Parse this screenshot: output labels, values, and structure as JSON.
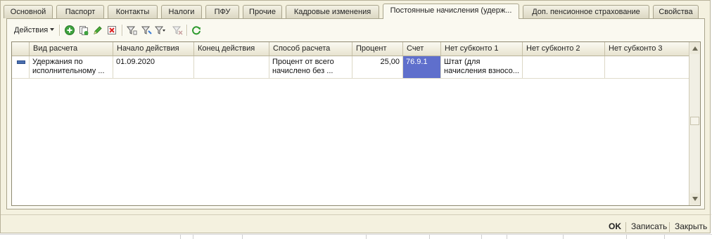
{
  "tabs": [
    {
      "label": "Основной",
      "active": false
    },
    {
      "label": "Паспорт",
      "active": false
    },
    {
      "label": "Контакты",
      "active": false
    },
    {
      "label": "Налоги",
      "active": false
    },
    {
      "label": "ПФУ",
      "active": false
    },
    {
      "label": "Прочие",
      "active": false
    },
    {
      "label": "Кадровые изменения",
      "active": false
    },
    {
      "label": "Постоянные начисления (удерж...",
      "active": true
    },
    {
      "label": "Доп. пенсионное страхование",
      "active": false
    },
    {
      "label": "Свойства",
      "active": false
    }
  ],
  "toolbar": {
    "actions_label": "Действия",
    "icons": [
      "add-icon",
      "copy-icon",
      "edit-icon",
      "delete-icon",
      "filter-icon",
      "filter-by-value-icon",
      "filter-dropdown-icon",
      "clear-filter-icon",
      "refresh-icon"
    ]
  },
  "table": {
    "columns": [
      "",
      "Вид расчета",
      "Начало действия",
      "Конец действия",
      "Способ расчета",
      "Процент",
      "Счет",
      "Нет субконто 1",
      "Нет субконто 2",
      "Нет субконто 3"
    ],
    "rows": [
      {
        "vid_l1": "Удержания по",
        "vid_l2": "исполнительному ...",
        "start": "01.09.2020",
        "end": "",
        "method_l1": "Процент от всего",
        "method_l2": "начислено без ...",
        "percent": "25,00",
        "account": "76.9.1",
        "sub1_l1": "Штат (для",
        "sub1_l2": "начисления взносо...",
        "sub2": "",
        "sub3": ""
      }
    ]
  },
  "buttons": {
    "ok": "OK",
    "save": "Записать",
    "close": "Закрыть"
  },
  "colors": {
    "selection": "#5f6fcc",
    "background": "#f4f1df"
  }
}
